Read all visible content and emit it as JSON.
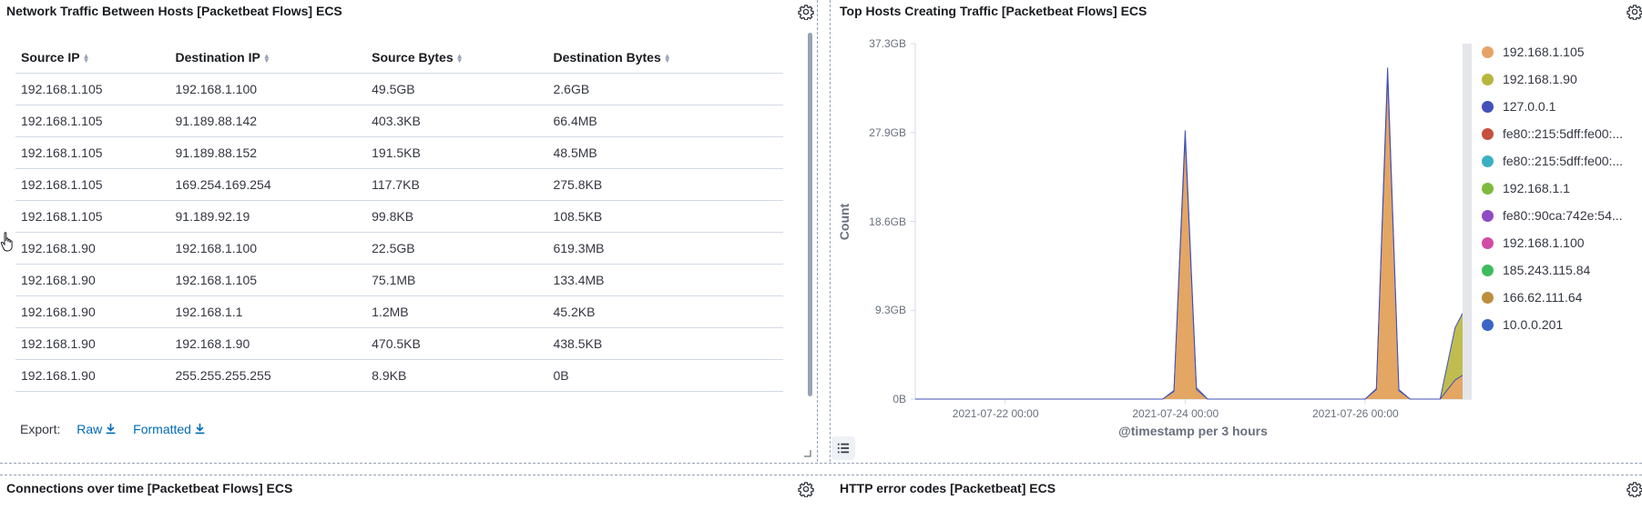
{
  "panels": {
    "traffic_table": {
      "title": "Network Traffic Between Hosts [Packetbeat Flows] ECS",
      "columns": [
        "Source IP",
        "Destination IP",
        "Source Bytes",
        "Destination Bytes"
      ],
      "rows": [
        [
          "192.168.1.105",
          "192.168.1.100",
          "49.5GB",
          "2.6GB"
        ],
        [
          "192.168.1.105",
          "91.189.88.142",
          "403.3KB",
          "66.4MB"
        ],
        [
          "192.168.1.105",
          "91.189.88.152",
          "191.5KB",
          "48.5MB"
        ],
        [
          "192.168.1.105",
          "169.254.169.254",
          "117.7KB",
          "275.8KB"
        ],
        [
          "192.168.1.105",
          "91.189.92.19",
          "99.8KB",
          "108.5KB"
        ],
        [
          "192.168.1.90",
          "192.168.1.100",
          "22.5GB",
          "619.3MB"
        ],
        [
          "192.168.1.90",
          "192.168.1.105",
          "75.1MB",
          "133.4MB"
        ],
        [
          "192.168.1.90",
          "192.168.1.1",
          "1.2MB",
          "45.2KB"
        ],
        [
          "192.168.1.90",
          "192.168.1.90",
          "470.5KB",
          "438.5KB"
        ],
        [
          "192.168.1.90",
          "255.255.255.255",
          "8.9KB",
          "0B"
        ]
      ],
      "export_label": "Export:",
      "export_raw": "Raw",
      "export_formatted": "Formatted"
    },
    "top_hosts": {
      "title": "Top Hosts Creating Traffic [Packetbeat Flows] ECS"
    },
    "connections": {
      "title": "Connections over time [Packetbeat Flows] ECS"
    },
    "http_errors": {
      "title": "HTTP error codes [Packetbeat] ECS"
    }
  },
  "chart_data": {
    "type": "area",
    "ylabel": "Count",
    "xlabel": "@timestamp per 3 hours",
    "y_ticks": [
      "37.3GB",
      "27.9GB",
      "18.6GB",
      "9.3GB",
      "0B"
    ],
    "x_ticks": [
      "2021-07-22 00:00",
      "2021-07-24 00:00",
      "2021-07-26 00:00"
    ],
    "ylim_gb": [
      0,
      37.3
    ],
    "x_unit": "hours since 2021-07-21 00:00",
    "series": [
      {
        "name": "192.168.1.105",
        "color": "#e7a365",
        "points": [
          [
            0,
            0
          ],
          [
            66,
            0
          ],
          [
            69,
            0.8
          ],
          [
            72,
            27.5
          ],
          [
            75,
            1.0
          ],
          [
            78,
            0
          ],
          [
            120,
            0
          ],
          [
            123,
            1.0
          ],
          [
            126,
            34.0
          ],
          [
            129,
            0.9
          ],
          [
            132,
            0
          ],
          [
            140,
            0
          ],
          [
            144,
            2.0
          ],
          [
            146,
            2.5
          ]
        ]
      },
      {
        "name": "192.168.1.90",
        "color": "#b8b63d",
        "points": [
          [
            0,
            0
          ],
          [
            66,
            0
          ],
          [
            69,
            0.9
          ],
          [
            72,
            28.2
          ],
          [
            75,
            1.2
          ],
          [
            78,
            0
          ],
          [
            120,
            0
          ],
          [
            123,
            1.1
          ],
          [
            126,
            34.8
          ],
          [
            129,
            1.0
          ],
          [
            132,
            0
          ],
          [
            140,
            0
          ],
          [
            144,
            7.5
          ],
          [
            146,
            9.0
          ]
        ]
      },
      {
        "name": "127.0.0.1",
        "color": "#4350b8"
      },
      {
        "name": "fe80::215:5dff:fe00:...",
        "color": "#c6503e"
      },
      {
        "name": "fe80::215:5dff:fe00:...",
        "color": "#3bb0c3"
      },
      {
        "name": "192.168.1.1",
        "color": "#7dba3d"
      },
      {
        "name": "fe80::90ca:742e:54...",
        "color": "#8e4bc4"
      },
      {
        "name": "192.168.1.100",
        "color": "#d14ba6"
      },
      {
        "name": "185.243.115.84",
        "color": "#3ebc5d"
      },
      {
        "name": "166.62.111.64",
        "color": "#bc8e3e"
      },
      {
        "name": "10.0.0.201",
        "color": "#3c66c4"
      }
    ]
  }
}
